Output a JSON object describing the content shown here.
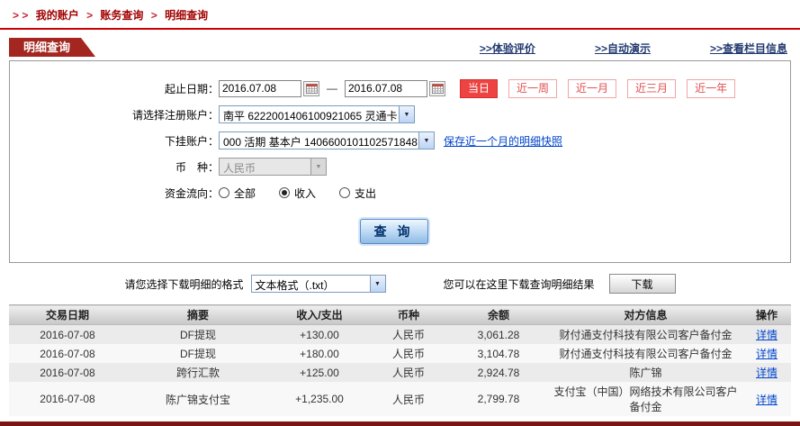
{
  "colors": {
    "accent_red": "#cc0000",
    "tab_bg": "#a32620",
    "amount_red": "#e60000",
    "link_blue": "#0044cc",
    "query_button_blue": "#8fbbe4"
  },
  "breadcrumb": {
    "prefix": "> >",
    "separator": ">",
    "items": [
      "我的账户",
      "账务查询",
      "明细查询"
    ]
  },
  "tab": {
    "title": "明细查询"
  },
  "header_links": [
    ">>体验评价",
    ">>自动演示",
    ">>查看栏目信息"
  ],
  "form": {
    "date_label": "起止日期：",
    "date_from": "2016.07.08",
    "date_to": "2016.07.08",
    "date_dash": "—",
    "quick_buttons": [
      "当日",
      "近一周",
      "近一月",
      "近三月",
      "近一年"
    ],
    "account_label": "请选择注册账户：",
    "account_value": "南平 6222001406100921065 灵通卡",
    "sub_account_label": "下挂账户：",
    "sub_account_value": "000 活期 基本户 1406600101102571848",
    "snapshot_link": "保存近一个月的明细快照",
    "currency_label": "币　种：",
    "currency_value": "人民币",
    "flow_label": "资金流向：",
    "flow_options": [
      "全部",
      "收入",
      "支出"
    ],
    "flow_selected_index": 1,
    "query_button": "查 询"
  },
  "download": {
    "format_label": "请您选择下载明细的格式",
    "format_value": "文本格式（.txt）",
    "hint": "您可以在这里下载查询明细结果",
    "button": "下载"
  },
  "table": {
    "headers": [
      "交易日期",
      "摘要",
      "收入/支出",
      "币种",
      "余额",
      "对方信息",
      "操作"
    ],
    "rows": [
      {
        "date": "2016-07-08",
        "summary": "DF提现",
        "amount": "+130.00",
        "currency": "人民币",
        "balance": "3,061.28",
        "counterparty": "财付通支付科技有限公司客户备付金",
        "action": "详情"
      },
      {
        "date": "2016-07-08",
        "summary": "DF提现",
        "amount": "+180.00",
        "currency": "人民币",
        "balance": "3,104.78",
        "counterparty": "财付通支付科技有限公司客户备付金",
        "action": "详情"
      },
      {
        "date": "2016-07-08",
        "summary": "跨行汇款",
        "amount": "+125.00",
        "currency": "人民币",
        "balance": "2,924.78",
        "counterparty": "陈广锦",
        "action": "详情"
      },
      {
        "date": "2016-07-08",
        "summary": "陈广锦支付宝",
        "amount": "+1,235.00",
        "currency": "人民币",
        "balance": "2,799.78",
        "counterparty": "支付宝（中国）网络技术有限公司客户备付金",
        "action": "详情"
      }
    ]
  }
}
